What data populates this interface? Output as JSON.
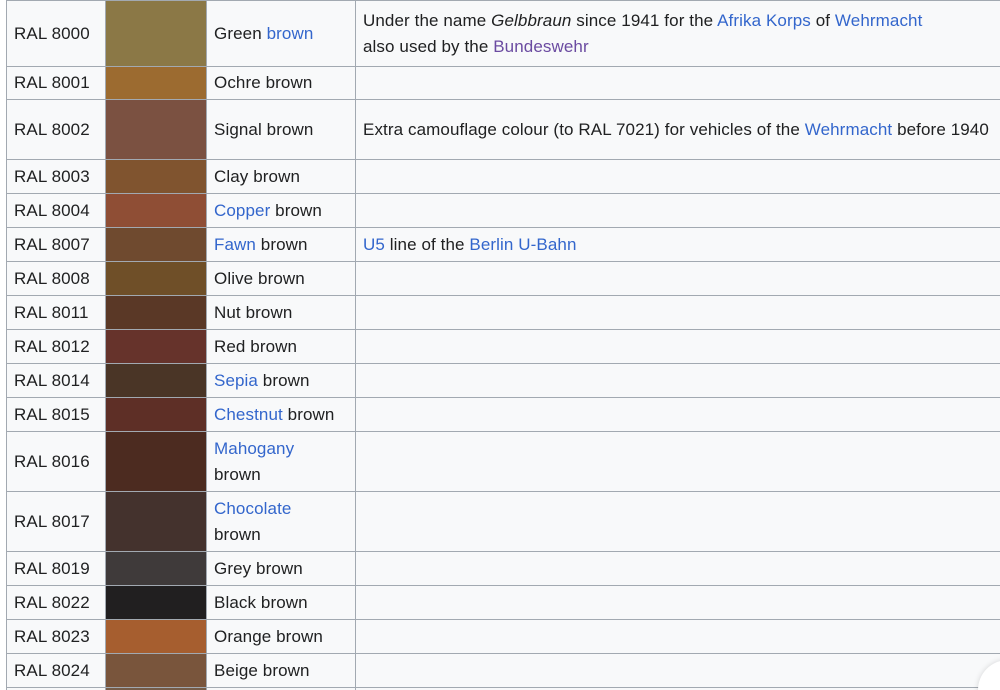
{
  "rows": [
    {
      "code": "RAL 8000",
      "color": "#8b7846",
      "name_link": "",
      "name_text": "Green ",
      "name_link_after": "brown",
      "height": 66
    },
    {
      "code": "RAL 8001",
      "color": "#9c6b30",
      "name_link": "",
      "name_text": "Ochre brown",
      "name_link_after": "",
      "height": 33
    },
    {
      "code": "RAL 8002",
      "color": "#7b5141",
      "name_link": "",
      "name_text": "Signal brown",
      "name_link_after": "",
      "height": 60
    },
    {
      "code": "RAL 8003",
      "color": "#80542f",
      "name_link": "",
      "name_text": "Clay brown",
      "name_link_after": "",
      "height": 34
    },
    {
      "code": "RAL 8004",
      "color": "#8f4e35",
      "name_link": "Copper",
      "name_text": " brown",
      "name_link_after": "",
      "height": 34
    },
    {
      "code": "RAL 8007",
      "color": "#6f4a2f",
      "name_link": "Fawn",
      "name_text": " brown",
      "name_link_after": "",
      "height": 34
    },
    {
      "code": "RAL 8008",
      "color": "#6f4f28",
      "name_link": "",
      "name_text": "Olive brown",
      "name_link_after": "",
      "height": 34
    },
    {
      "code": "RAL 8011",
      "color": "#5a3826",
      "name_link": "",
      "name_text": "Nut brown",
      "name_link_after": "",
      "height": 34
    },
    {
      "code": "RAL 8012",
      "color": "#66332b",
      "name_link": "",
      "name_text": "Red brown",
      "name_link_after": "",
      "height": 34
    },
    {
      "code": "RAL 8014",
      "color": "#4a3526",
      "name_link": "Sepia",
      "name_text": " brown",
      "name_link_after": "",
      "height": 34
    },
    {
      "code": "RAL 8015",
      "color": "#5e2f26",
      "name_link": "Chestnut",
      "name_text": " brown",
      "name_link_after": "",
      "height": 34
    },
    {
      "code": "RAL 8016",
      "color": "#4c2b20",
      "name_link": "Mahogany",
      "name_text": "brown",
      "name_link_after": "",
      "height": 60,
      "wrap": true
    },
    {
      "code": "RAL 8017",
      "color": "#44322d",
      "name_link": "Chocolate",
      "name_text": "brown",
      "name_link_after": "",
      "height": 60,
      "wrap": true
    },
    {
      "code": "RAL 8019",
      "color": "#3f3a3a",
      "name_link": "",
      "name_text": "Grey brown",
      "name_link_after": "",
      "height": 34
    },
    {
      "code": "RAL 8022",
      "color": "#211f20",
      "name_link": "",
      "name_text": "Black brown",
      "name_link_after": "",
      "height": 34
    },
    {
      "code": "RAL 8023",
      "color": "#a65e2f",
      "name_link": "",
      "name_text": "Orange brown",
      "name_link_after": "",
      "height": 34
    },
    {
      "code": "RAL 8024",
      "color": "#79553c",
      "name_link": "",
      "name_text": "Beige brown",
      "name_link_after": "",
      "height": 34
    },
    {
      "code": "",
      "color": "#755c48",
      "name_link": "",
      "name_text": "",
      "name_link_after": "",
      "height": 34
    }
  ],
  "notes": {
    "r8000": {
      "t1": "Under the name ",
      "em": "Gelbbraun",
      "t2": " since 1941 for the ",
      "link1": "Afrika Korps",
      "t3": " of ",
      "link2": "Wehrmacht",
      "t4": " also used by the ",
      "link3": "Bundeswehr"
    },
    "r8002": {
      "t1": "Extra camouflage colour (to RAL 7021) for vehicles of the ",
      "link1": "Wehrmacht",
      "t2": " before 1940"
    },
    "r8007": {
      "link1": "U5",
      "t1": " line of the ",
      "link2": "Berlin U-Bahn"
    }
  }
}
